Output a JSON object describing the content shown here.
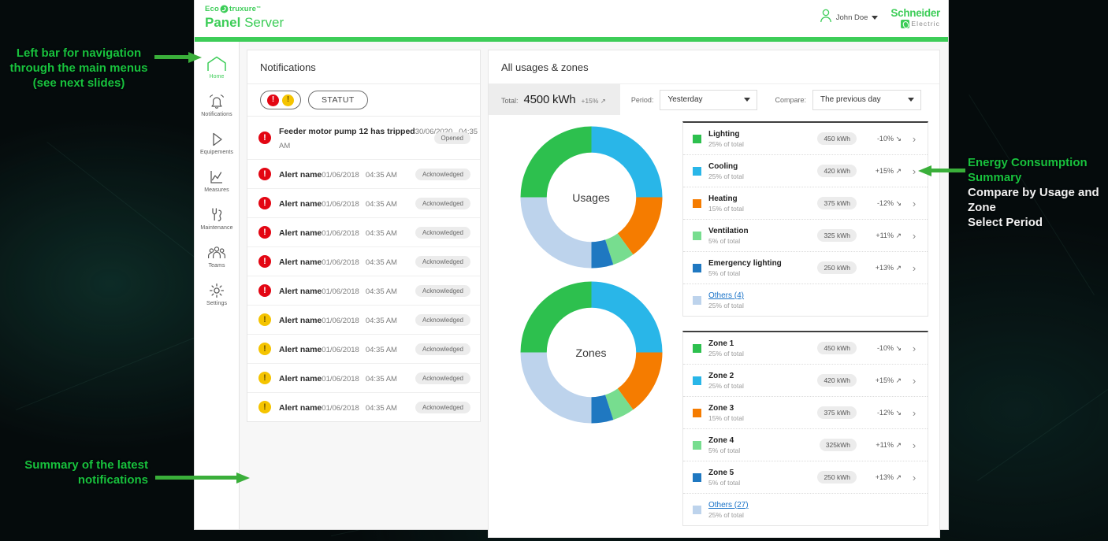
{
  "app": {
    "brand_eco": "Eco",
    "brand_eco2": "truxure",
    "brand_tm": "™",
    "title_bold": "Panel",
    "title_light": " Server",
    "user_name": "John Doe",
    "logo_line1": "Schneider",
    "logo_line2": "Electric"
  },
  "sidebar": {
    "items": [
      {
        "label": "Home",
        "icon": "home-icon",
        "active": true
      },
      {
        "label": "Notifications",
        "icon": "bell-icon",
        "active": false
      },
      {
        "label": "Equipements",
        "icon": "play-triangle-icon",
        "active": false
      },
      {
        "label": "Measures",
        "icon": "chart-line-icon",
        "active": false
      },
      {
        "label": "Maintenance",
        "icon": "wrench-icon",
        "active": false
      },
      {
        "label": "Teams",
        "icon": "people-icon",
        "active": false
      },
      {
        "label": "Settings",
        "icon": "gear-icon",
        "active": false
      }
    ]
  },
  "notifications": {
    "title": "Notifications",
    "filter_severity_red": "!",
    "filter_severity_yellow": "!",
    "filter_status_label": "STATUT",
    "rows": [
      {
        "sev": "red",
        "title": "Feeder motor pump 12 has tripped",
        "date": "30/06/2020",
        "time": "04:35 AM",
        "status": "Opened"
      },
      {
        "sev": "red",
        "title": "Alert name",
        "date": "01/06/2018",
        "time": "04:35 AM",
        "status": "Acknowledged"
      },
      {
        "sev": "red",
        "title": "Alert name",
        "date": "01/06/2018",
        "time": "04:35 AM",
        "status": "Acknowledged"
      },
      {
        "sev": "red",
        "title": "Alert name",
        "date": "01/06/2018",
        "time": "04:35 AM",
        "status": "Acknowledged"
      },
      {
        "sev": "red",
        "title": "Alert name",
        "date": "01/06/2018",
        "time": "04:35 AM",
        "status": "Acknowledged"
      },
      {
        "sev": "red",
        "title": "Alert name",
        "date": "01/06/2018",
        "time": "04:35 AM",
        "status": "Acknowledged"
      },
      {
        "sev": "yellow",
        "title": "Alert name",
        "date": "01/06/2018",
        "time": "04:35 AM",
        "status": "Acknowledged"
      },
      {
        "sev": "yellow",
        "title": "Alert name",
        "date": "01/06/2018",
        "time": "04:35 AM",
        "status": "Acknowledged"
      },
      {
        "sev": "yellow",
        "title": "Alert name",
        "date": "01/06/2018",
        "time": "04:35 AM",
        "status": "Acknowledged"
      },
      {
        "sev": "yellow",
        "title": "Alert name",
        "date": "01/06/2018",
        "time": "04:35 AM",
        "status": "Acknowledged"
      }
    ]
  },
  "usages_zones": {
    "title": "All usages & zones",
    "total_label": "Total:",
    "total_value": "4500 kWh",
    "total_delta": "+15% ↗",
    "period_label": "Period:",
    "period_value": "Yesterday",
    "compare_label": "Compare:",
    "compare_value": "The previous day",
    "usages_center": "Usages",
    "zones_center": "Zones",
    "usages": [
      {
        "name": "Lighting",
        "sub": "25% of total",
        "kwh": "450 kWh",
        "delta": "-10% ↘",
        "color": "#2DC04E",
        "link": false
      },
      {
        "name": "Cooling",
        "sub": "25% of total",
        "kwh": "420 kWh",
        "delta": "+15% ↗",
        "color": "#29B6E8",
        "link": false
      },
      {
        "name": "Heating",
        "sub": "15% of total",
        "kwh": "375 kWh",
        "delta": "-12% ↘",
        "color": "#F57C00",
        "link": false
      },
      {
        "name": "Ventilation",
        "sub": "5% of total",
        "kwh": "325 kWh",
        "delta": "+11% ↗",
        "color": "#77DD8F",
        "link": false
      },
      {
        "name": "Emergency lighting",
        "sub": "5% of total",
        "kwh": "250 kWh",
        "delta": "+13% ↗",
        "color": "#1F78C1",
        "link": false
      },
      {
        "name": "Others (4)",
        "sub": "25% of total",
        "kwh": "",
        "delta": "",
        "color": "#BDD3EC",
        "link": true
      }
    ],
    "zones": [
      {
        "name": "Zone 1",
        "sub": "25% of total",
        "kwh": "450 kWh",
        "delta": "-10% ↘",
        "color": "#2DC04E",
        "link": false
      },
      {
        "name": "Zone 2",
        "sub": "25% of total",
        "kwh": "420 kWh",
        "delta": "+15% ↗",
        "color": "#29B6E8",
        "link": false
      },
      {
        "name": "Zone 3",
        "sub": "15% of total",
        "kwh": "375 kWh",
        "delta": "-12% ↘",
        "color": "#F57C00",
        "link": false
      },
      {
        "name": "Zone 4",
        "sub": "5% of total",
        "kwh": "325kWh",
        "delta": "+11% ↗",
        "color": "#77DD8F",
        "link": false
      },
      {
        "name": "Zone 5",
        "sub": "5% of total",
        "kwh": "250 kWh",
        "delta": "+13% ↗",
        "color": "#1F78C1",
        "link": false
      },
      {
        "name": "Others (27)",
        "sub": "25% of total",
        "kwh": "",
        "delta": "",
        "color": "#BDD3EC",
        "link": true
      }
    ]
  },
  "chart_data": [
    {
      "type": "pie",
      "title": "Usages",
      "categories": [
        "Cooling",
        "Heating",
        "Ventilation",
        "Emergency lighting",
        "Others (4)",
        "Lighting"
      ],
      "values": [
        25,
        15,
        5,
        5,
        25,
        25
      ],
      "unit": "% of total",
      "colors": [
        "#29B6E8",
        "#F57C00",
        "#77DD8F",
        "#1F78C1",
        "#BDD3EC",
        "#2DC04E"
      ],
      "legend": "right",
      "start_angle_deg": 0,
      "donut_inner_ratio": 0.63
    },
    {
      "type": "pie",
      "title": "Zones",
      "categories": [
        "Zone 2",
        "Zone 3",
        "Zone 4",
        "Zone 5",
        "Others (27)",
        "Zone 1"
      ],
      "values": [
        25,
        15,
        5,
        5,
        25,
        25
      ],
      "unit": "% of total",
      "colors": [
        "#29B6E8",
        "#F57C00",
        "#77DD8F",
        "#1F78C1",
        "#BDD3EC",
        "#2DC04E"
      ],
      "legend": "right",
      "start_angle_deg": 0,
      "donut_inner_ratio": 0.63
    }
  ],
  "annotations": {
    "nav": "Left bar for navigation\nthrough the main menus\n(see next slides)",
    "nav_l1": "Left bar for navigation",
    "nav_l2": "through the main menus",
    "nav_l3": "(see next slides)",
    "notif_l1": "Summary of the latest",
    "notif_l2": "notifications",
    "energy_l1": "Energy Consumption",
    "energy_l2": "Summary",
    "energy_l3": "Compare by Usage and",
    "energy_l4": "Zone",
    "energy_l5": "Select Period"
  }
}
